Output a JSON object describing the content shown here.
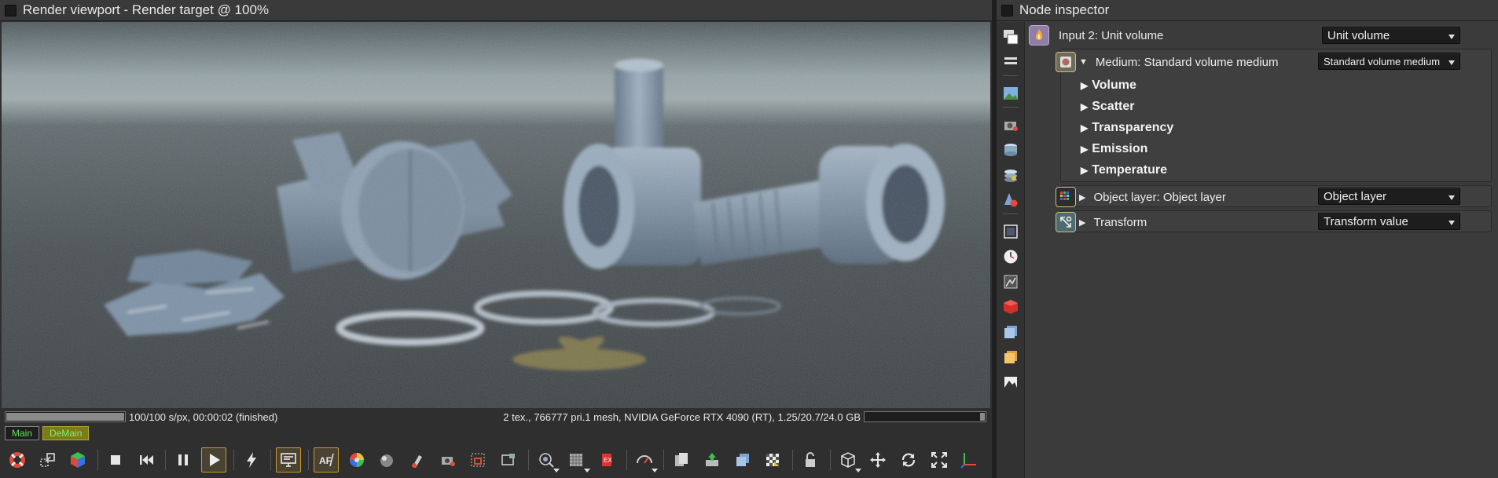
{
  "viewport": {
    "title": "Render viewport - Render target @ 100%",
    "status_left": "100/100 s/px, 00:00:02 (finished)",
    "status_right": "2 tex., 766777 pri.1 mesh, NVIDIA GeForce RTX 4090 (RT), 1.25/20.7/24.0 GB",
    "render_progress": 1.0,
    "memory_usage": 0.05,
    "tabs": [
      {
        "label": "Main"
      },
      {
        "label": "DeMain"
      }
    ],
    "toolbar_icons": [
      "lifebuoy-icon",
      "resize-icon",
      "rgb-cube-icon",
      "stop-icon",
      "skip-back-icon",
      "pause-icon",
      "play-icon",
      "lightning-icon",
      "monitor-icon",
      "af-focus-icon",
      "color-wheel-icon",
      "sphere-icon",
      "material-picker-icon",
      "camera-picker-icon",
      "region-icon",
      "film-region-icon",
      "lock-region-icon",
      "clay-mode-icon",
      "subsample-icon",
      "export-icon",
      "gauge-icon",
      "copy-icon",
      "upload-icon",
      "cube-stack-icon",
      "checker-icon",
      "lock-icon",
      "wire-cube-icon",
      "move-icon",
      "rotate-icon",
      "fit-icon",
      "axis-icon"
    ]
  },
  "inspector": {
    "title": "Node inspector",
    "input": {
      "label": "Input 2: Unit volume",
      "value": "Unit volume"
    },
    "medium": {
      "label": "Medium: Standard volume medium",
      "value": "Standard volume medium"
    },
    "groups": [
      {
        "label": "Volume"
      },
      {
        "label": "Scatter"
      },
      {
        "label": "Transparency"
      },
      {
        "label": "Emission"
      },
      {
        "label": "Temperature"
      }
    ],
    "object_layer": {
      "label": "Object layer: Object layer",
      "value": "Object layer"
    },
    "transform": {
      "label": "Transform",
      "value": "Transform value"
    },
    "side_icons": [
      "windows-icon",
      "list-icon",
      "image-icon",
      "camera-icon",
      "geometry-icon",
      "mesh-icon",
      "material-icon",
      "frame-icon",
      "clock-icon",
      "texture-icon",
      "red-cube-icon",
      "blue-cube-icon",
      "yellow-cube-icon",
      "mountain-icon"
    ]
  }
}
